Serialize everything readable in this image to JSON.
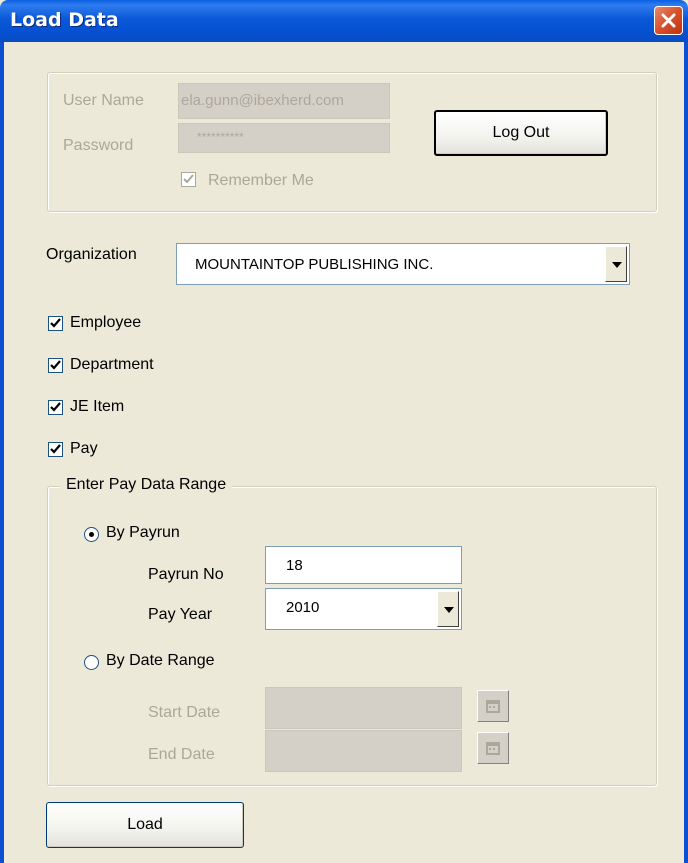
{
  "window": {
    "title": "Load Data"
  },
  "login": {
    "username_label": "User Name",
    "username_value": "ela.gunn@ibexherd.com",
    "password_label": "Password",
    "password_value": "**********",
    "logout_label": "Log Out",
    "remember_label": "Remember Me",
    "remember_checked": true
  },
  "organization": {
    "label": "Organization",
    "selected": "MOUNTAINTOP PUBLISHING INC."
  },
  "options": [
    {
      "label": "Employee",
      "checked": true
    },
    {
      "label": "Department",
      "checked": true
    },
    {
      "label": "JE Item",
      "checked": true
    },
    {
      "label": "Pay",
      "checked": true
    }
  ],
  "pay_range": {
    "legend": "Enter Pay Data Range",
    "by_payrun_label": "By Payrun",
    "by_payrun_selected": true,
    "payrun_no_label": "Payrun No",
    "payrun_no_value": "18",
    "pay_year_label": "Pay Year",
    "pay_year_value": "2010",
    "by_date_label": "By Date Range",
    "start_date_label": "Start Date",
    "end_date_label": "End Date"
  },
  "actions": {
    "load_label": "Load"
  }
}
